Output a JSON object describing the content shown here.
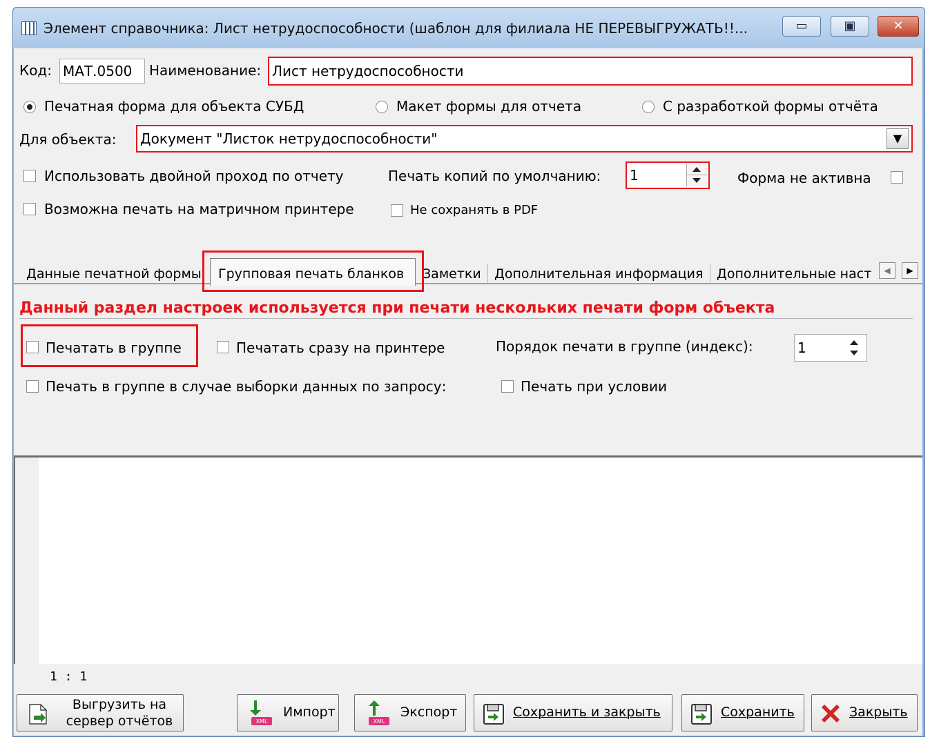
{
  "window": {
    "title": "Элемент справочника: Лист нетрудоспособности (шаблон для филиала НЕ ПЕРЕВЫГРУЖАТЬ!!...",
    "controls": {
      "minimize": "▭",
      "maximize": "▣",
      "close": "✕"
    }
  },
  "header": {
    "code_label": "Код:",
    "code_value": "МАТ.0500",
    "name_label": "Наименование:",
    "name_value": "Лист нетрудоспособности"
  },
  "mode_radios": [
    {
      "label": "Печатная форма для объекта СУБД",
      "selected": true
    },
    {
      "label": "Макет формы для отчета",
      "selected": false
    },
    {
      "label": "С разработкой формы отчёта",
      "selected": false
    }
  ],
  "object": {
    "label": "Для объекта:",
    "value": "Документ \"Листок нетрудоспособности\"",
    "dropdown_glyph": "▼"
  },
  "options": {
    "double_pass": "Использовать двойной проход по отчету",
    "copies_label": "Печать копий по умолчанию:",
    "copies_value": "1",
    "inactive": "Форма не активна",
    "matrix_printer": "Возможна печать на матричном принтере",
    "no_pdf": "Не сохранять в PDF"
  },
  "tabs": [
    {
      "label": "Данные печатной формы",
      "active": false
    },
    {
      "label": "Групповая печать бланков",
      "active": true
    },
    {
      "label": "Заметки",
      "active": false
    },
    {
      "label": "Дополнительная информация",
      "active": false
    },
    {
      "label": "Дополнительные наст",
      "active": false
    }
  ],
  "tab_scroll": {
    "left": "◀",
    "right": "▶"
  },
  "group_print": {
    "notice": "Данный раздел настроек используется при печати нескольких печати форм объекта",
    "print_in_group": "Печатать в группе",
    "print_direct": "Печатать сразу на принтере",
    "order_label": "Порядок печати в группе (индекс):",
    "order_value": "1",
    "print_on_query": "Печать в группе в случае выборки данных по запросу:",
    "print_on_condition": "Печать при условии"
  },
  "editor": {
    "cursor_pos": "1 : 1"
  },
  "buttons": {
    "upload": "Выгрузить на сервер отчётов",
    "import": "Импорт",
    "export": "Экспорт",
    "save_close": "Сохранить и закрыть",
    "save": "Сохранить",
    "close": "Закрыть",
    "xml_badge": "XML"
  },
  "colors": {
    "highlight": "#e8151b",
    "notice": "#e8151b",
    "titlebar": "#a9c7e8"
  }
}
